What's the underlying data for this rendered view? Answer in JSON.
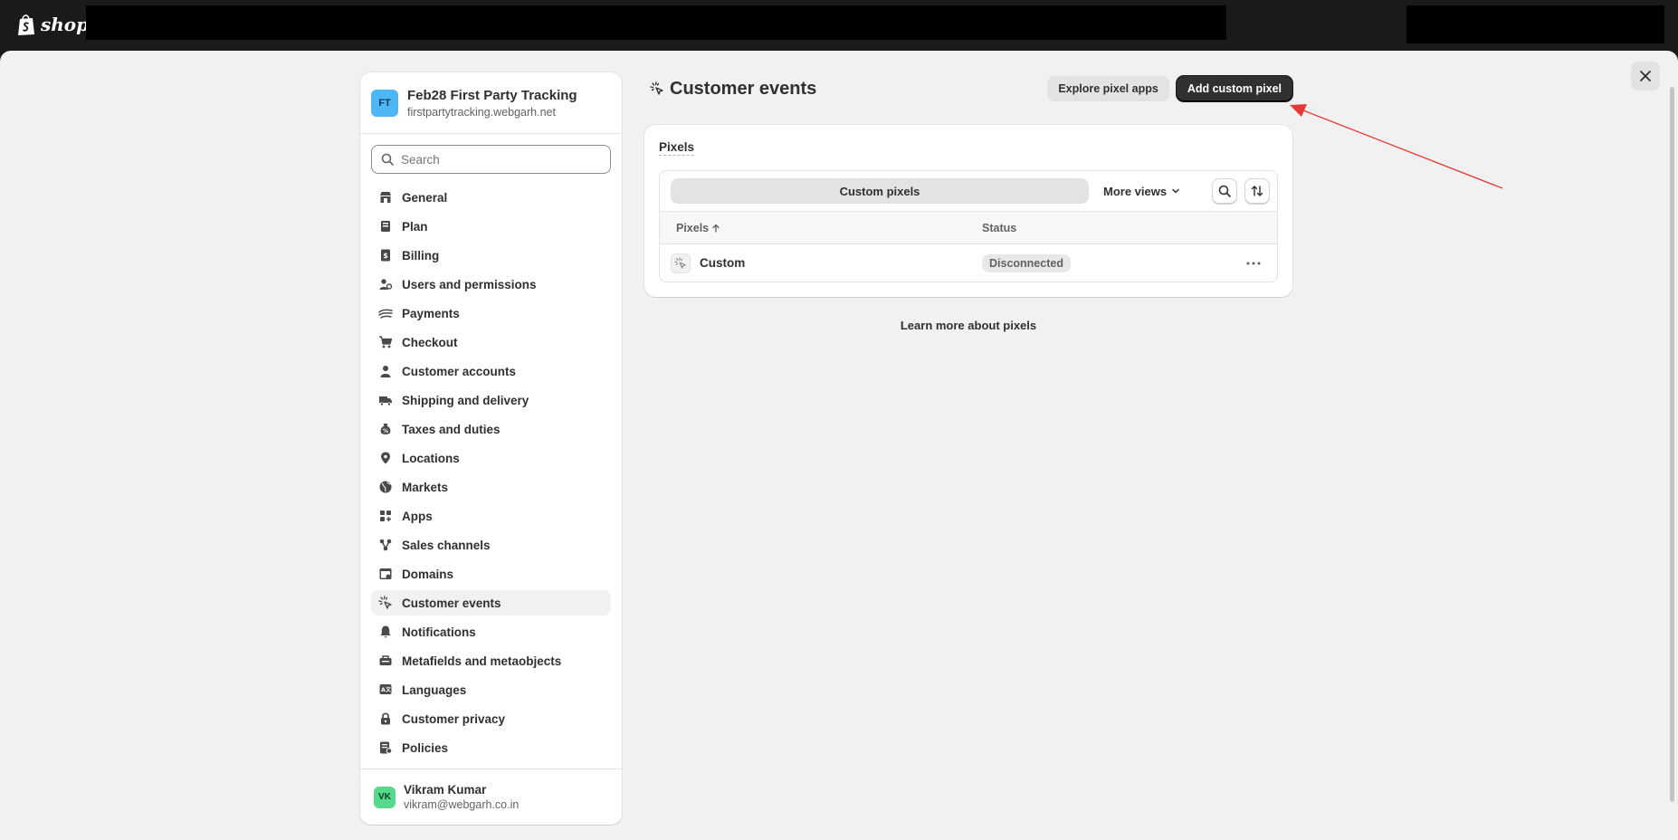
{
  "brand": {
    "wordmark": "shopif"
  },
  "store": {
    "initials": "FT",
    "name": "Feb28 First Party Tracking",
    "url": "firstpartytracking.webgarh.net"
  },
  "search": {
    "placeholder": "Search"
  },
  "sidebar": {
    "items": [
      {
        "label": "General",
        "icon": "store-icon"
      },
      {
        "label": "Plan",
        "icon": "plan-icon"
      },
      {
        "label": "Billing",
        "icon": "billing-icon"
      },
      {
        "label": "Users and permissions",
        "icon": "users-icon"
      },
      {
        "label": "Payments",
        "icon": "payments-icon"
      },
      {
        "label": "Checkout",
        "icon": "cart-icon"
      },
      {
        "label": "Customer accounts",
        "icon": "person-icon"
      },
      {
        "label": "Shipping and delivery",
        "icon": "truck-icon"
      },
      {
        "label": "Taxes and duties",
        "icon": "tax-icon"
      },
      {
        "label": "Locations",
        "icon": "location-icon"
      },
      {
        "label": "Markets",
        "icon": "globe-icon"
      },
      {
        "label": "Apps",
        "icon": "apps-icon"
      },
      {
        "label": "Sales channels",
        "icon": "channels-icon"
      },
      {
        "label": "Domains",
        "icon": "domain-icon"
      },
      {
        "label": "Customer events",
        "icon": "pixel-icon",
        "active": true
      },
      {
        "label": "Notifications",
        "icon": "bell-icon"
      },
      {
        "label": "Metafields and metaobjects",
        "icon": "metafields-icon"
      },
      {
        "label": "Languages",
        "icon": "languages-icon"
      },
      {
        "label": "Customer privacy",
        "icon": "lock-icon"
      },
      {
        "label": "Policies",
        "icon": "policies-icon"
      }
    ]
  },
  "user": {
    "initials": "VK",
    "name": "Vikram Kumar",
    "email": "vikram@webgarh.co.in"
  },
  "page": {
    "title": "Customer events",
    "explore_button": "Explore pixel apps",
    "add_button": "Add custom pixel"
  },
  "pixels_card": {
    "title": "Pixels",
    "tab_active": "Custom pixels",
    "more_views": "More views",
    "columns": [
      "Pixels",
      "Status"
    ],
    "rows": [
      {
        "name": "Custom",
        "status": "Disconnected"
      }
    ]
  },
  "learn_more": "Learn more about pixels",
  "colors": {
    "store_avatar": "#4db7f6",
    "user_avatar": "#56d98b",
    "primary_button": "#303030",
    "annotation_arrow": "#e53935"
  }
}
